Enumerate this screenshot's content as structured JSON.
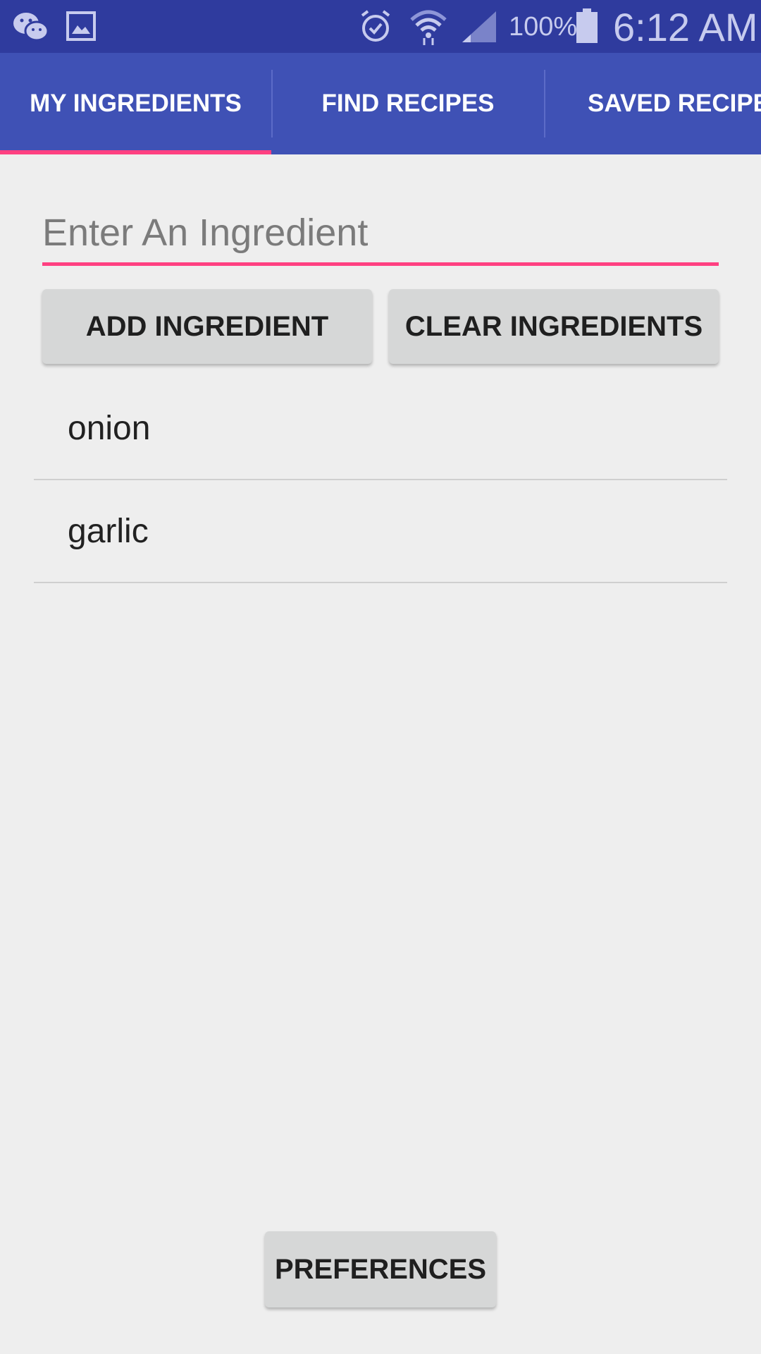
{
  "status_bar": {
    "battery_percent": "100%",
    "time": "6:12 AM",
    "icons": [
      "wechat-icon",
      "gallery-icon",
      "alarm-icon",
      "wifi-icon",
      "signal-icon",
      "battery-icon"
    ],
    "color": "#2f3b9e"
  },
  "tabs": [
    {
      "label": "MY INGREDIENTS",
      "selected": true
    },
    {
      "label": "FIND RECIPES",
      "selected": false
    },
    {
      "label": "SAVED RECIPES",
      "selected": false
    }
  ],
  "colors": {
    "primary": "#3f51b5",
    "accent": "#ff4081",
    "background": "#eeeeee",
    "button": "#d6d7d7"
  },
  "input": {
    "placeholder": "Enter An Ingredient",
    "value": ""
  },
  "buttons": {
    "add": "ADD INGREDIENT",
    "clear": "CLEAR INGREDIENTS",
    "preferences": "PREFERENCES"
  },
  "ingredients": [
    "onion",
    "garlic"
  ]
}
